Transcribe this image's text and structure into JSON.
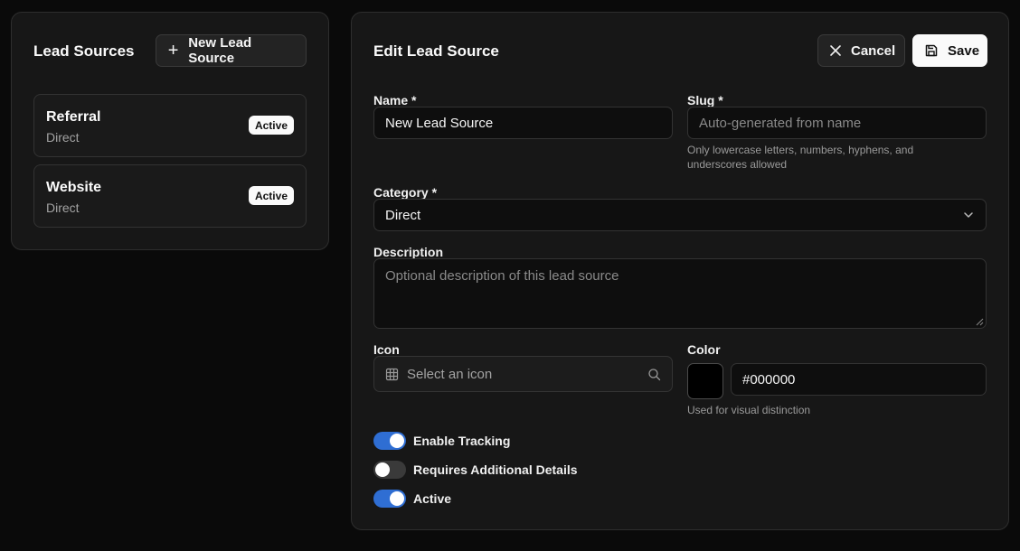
{
  "sidebar": {
    "title": "Lead Sources",
    "new_button_label": "New Lead Source",
    "sources": [
      {
        "name": "Referral",
        "category": "Direct",
        "status": "Active"
      },
      {
        "name": "Website",
        "category": "Direct",
        "status": "Active"
      }
    ]
  },
  "editor": {
    "title": "Edit Lead Source",
    "cancel_label": "Cancel",
    "save_label": "Save",
    "name": {
      "label": "Name *",
      "value": "New Lead Source"
    },
    "slug": {
      "label": "Slug *",
      "placeholder": "Auto-generated from name",
      "help": "Only lowercase letters, numbers, hyphens, and underscores allowed"
    },
    "category": {
      "label": "Category *",
      "value": "Direct"
    },
    "description": {
      "label": "Description",
      "placeholder": "Optional description of this lead source"
    },
    "icon": {
      "label": "Icon",
      "placeholder": "Select an icon"
    },
    "color": {
      "label": "Color",
      "value": "#000000",
      "help": "Used for visual distinction",
      "swatch": "#000000"
    },
    "toggles": [
      {
        "label": "Enable Tracking",
        "on": true
      },
      {
        "label": "Requires Additional Details",
        "on": false
      },
      {
        "label": "Active",
        "on": true
      }
    ]
  },
  "colors": {
    "accent": "#2f6ed3",
    "background": "#0a0a0a",
    "panel": "#171717"
  }
}
